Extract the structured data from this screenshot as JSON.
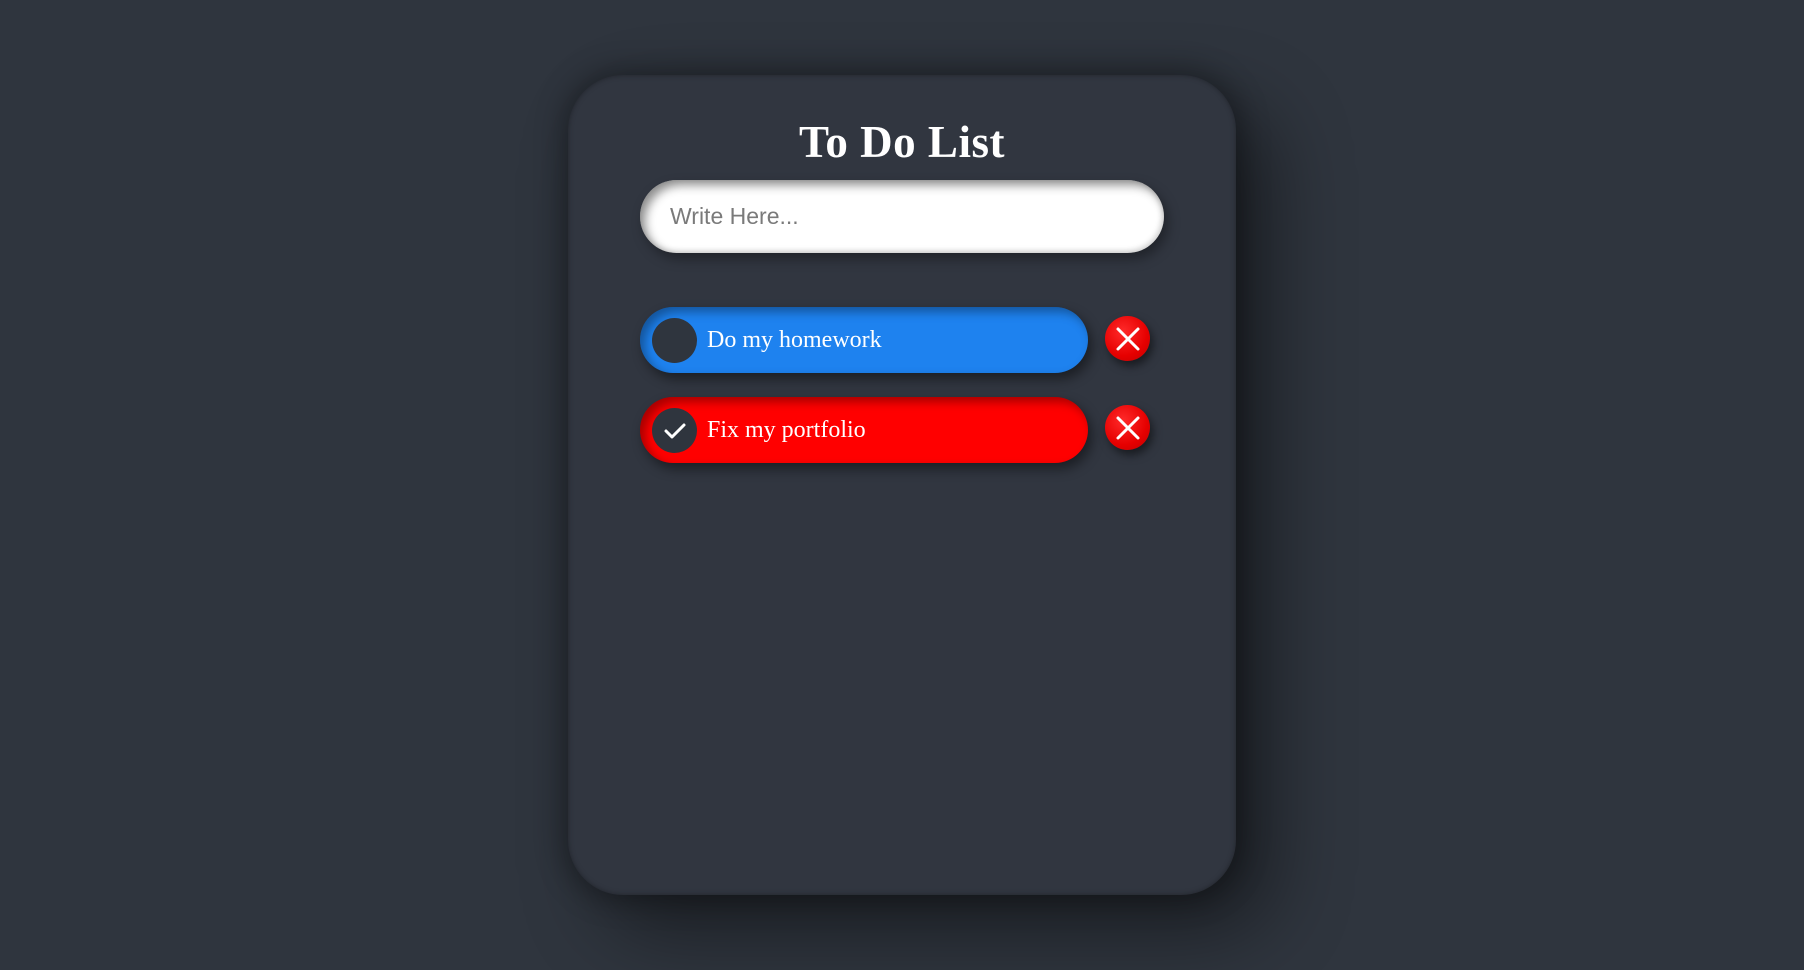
{
  "app": {
    "title": "To Do List"
  },
  "input": {
    "placeholder": "Write Here...",
    "value": ""
  },
  "tasks": [
    {
      "label": "Do my homework",
      "checked": false,
      "color": "#1e82ef"
    },
    {
      "label": "Fix my portfolio",
      "checked": true,
      "color": "#ff0000"
    }
  ],
  "icons": {
    "check": "check-icon",
    "delete": "close-icon"
  },
  "colors": {
    "background": "#2f353e",
    "card": "#313640",
    "accent_blue": "#1e82ef",
    "accent_red": "#ff0000"
  }
}
